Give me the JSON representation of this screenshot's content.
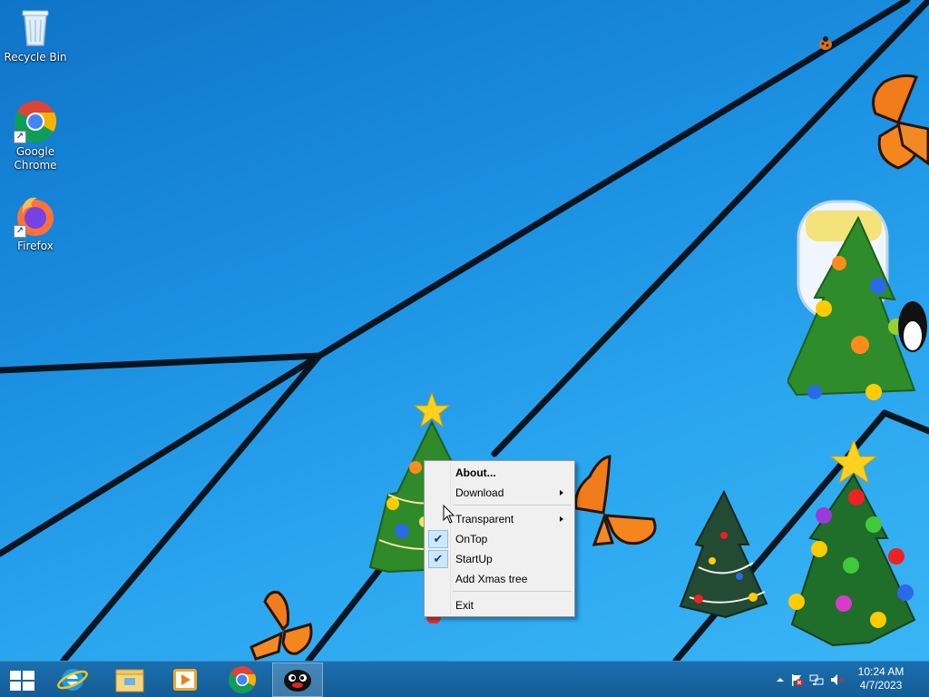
{
  "desktop_icons": [
    {
      "label": "Recycle Bin",
      "icon": "recycle-bin-icon"
    },
    {
      "label": "Google Chrome",
      "icon": "chrome-icon"
    },
    {
      "label": "Firefox",
      "icon": "firefox-icon"
    }
  ],
  "context_menu": {
    "items": [
      {
        "label": "About...",
        "bold": true
      },
      {
        "label": "Download",
        "submenu": true
      },
      {
        "label": "Transparent",
        "submenu": true
      },
      {
        "label": "OnTop",
        "checked": true
      },
      {
        "label": "StartUp",
        "checked": true
      },
      {
        "label": "Add Xmas tree"
      },
      {
        "label": "Exit"
      }
    ]
  },
  "taskbar": {
    "apps": [
      {
        "name": "Internet Explorer",
        "icon": "ie-icon"
      },
      {
        "name": "File Explorer",
        "icon": "folder-icon"
      },
      {
        "name": "Windows Media Player",
        "icon": "media-player-icon"
      },
      {
        "name": "Google Chrome",
        "icon": "chrome-icon"
      },
      {
        "name": "Xmas tree app",
        "icon": "penguin-icon",
        "active": true
      }
    ],
    "clock": {
      "time": "10:24 AM",
      "date": "4/7/2023"
    }
  },
  "colors": {
    "taskbar": "#1b6faf",
    "desktop": "#1a8ee0",
    "menu_bg": "#f0f0f0",
    "check_bg": "#cce8ff"
  }
}
